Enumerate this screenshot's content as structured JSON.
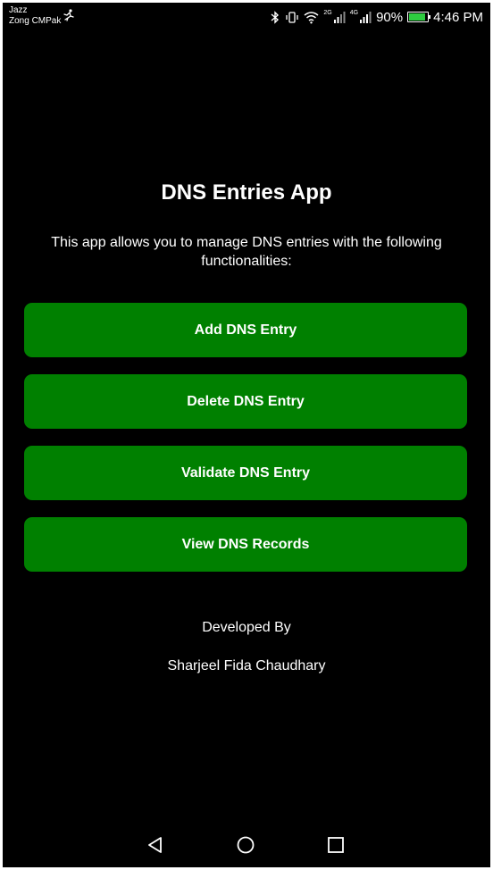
{
  "status_bar": {
    "carrier_line1": "Jazz",
    "carrier_line2": "Zong CMPak",
    "network_tag_1": "2G",
    "network_tag_2": "4G",
    "battery_percent_text": "90%",
    "battery_level": 0.9,
    "battery_color": "#2ecc40",
    "time": "4:46 PM",
    "icons": [
      "runner-icon",
      "bluetooth-icon",
      "vibrate-icon",
      "wifi-icon",
      "signal-icon",
      "signal-icon",
      "battery-icon"
    ]
  },
  "app": {
    "title": "DNS Entries App",
    "description": "This app allows you to manage DNS entries with the following functionalities:",
    "buttons": {
      "add": "Add DNS Entry",
      "delete": "Delete DNS Entry",
      "validate": "Validate DNS Entry",
      "view": "View DNS Records"
    },
    "developed_by_label": "Developed By",
    "developer_name": "Sharjeel Fida Chaudhary",
    "accent_color": "#008000"
  },
  "nav_bar": {
    "icons": [
      "back-icon",
      "home-icon",
      "recents-icon"
    ]
  }
}
